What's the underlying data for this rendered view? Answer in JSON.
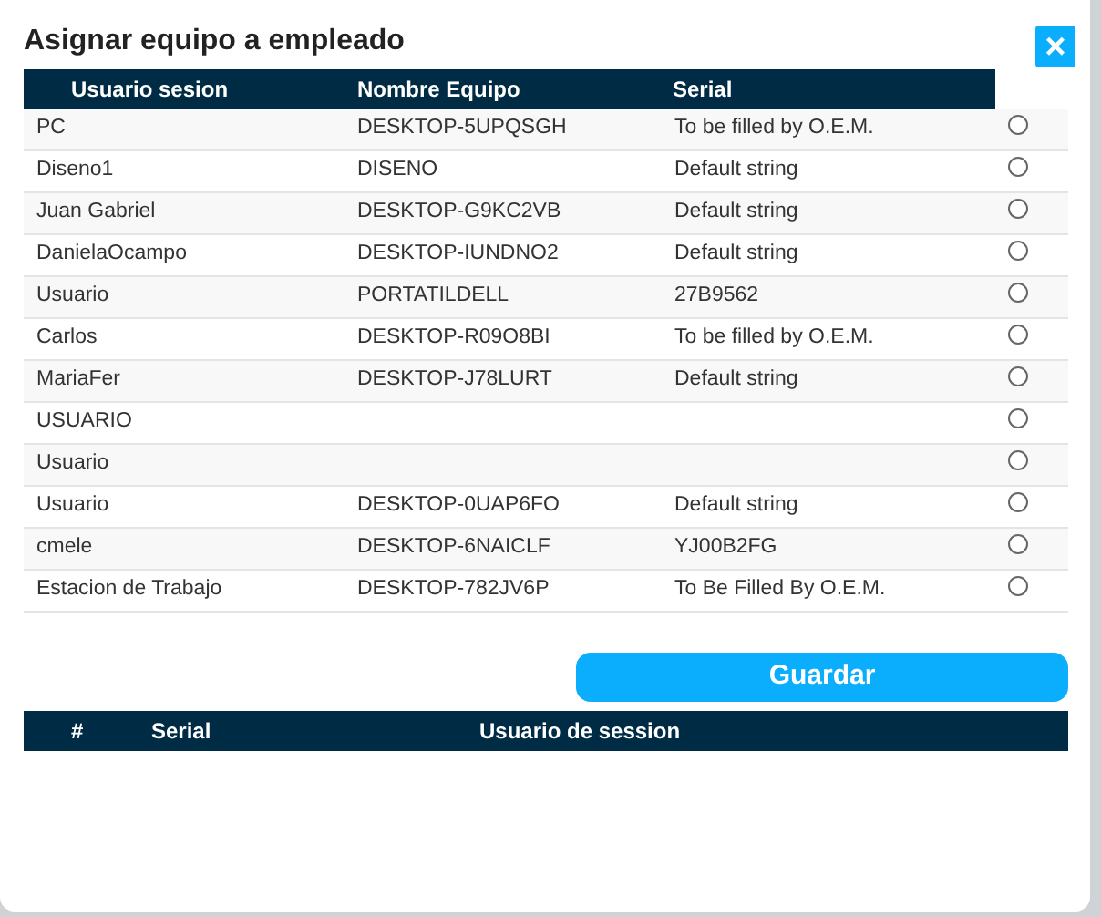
{
  "modal": {
    "title": "Asignar equipo a empleado",
    "close": "×"
  },
  "equipment_table": {
    "columns": [
      "Usuario sesion",
      "Nombre Equipo",
      "Serial"
    ],
    "rows": [
      {
        "user": "PC",
        "computer": "DESKTOP-5UPQSGH",
        "serial": "To be filled by O.E.M.",
        "selected": false
      },
      {
        "user": "Diseno1",
        "computer": "DISENO",
        "serial": "Default string",
        "selected": false
      },
      {
        "user": "Juan Gabriel",
        "computer": "DESKTOP-G9KC2VB",
        "serial": "Default string",
        "selected": false
      },
      {
        "user": "DanielaOcampo",
        "computer": "DESKTOP-IUNDNO2",
        "serial": "Default string",
        "selected": false
      },
      {
        "user": "Usuario",
        "computer": "PORTATILDELL",
        "serial": "27B9562",
        "selected": false
      },
      {
        "user": "Carlos",
        "computer": "DESKTOP-R09O8BI",
        "serial": "To be filled by O.E.M.",
        "selected": false
      },
      {
        "user": "MariaFer",
        "computer": "DESKTOP-J78LURT",
        "serial": "Default string",
        "selected": false
      },
      {
        "user": "USUARIO",
        "selected": false
      },
      {
        "user": "Usuario",
        "selected": false
      },
      {
        "user": "Usuario",
        "computer": "DESKTOP-0UAP6FO",
        "serial": "Default string",
        "selected": false
      },
      {
        "user": "cmele",
        "computer": "DESKTOP-6NAICLF",
        "serial": "YJ00B2FG",
        "selected": false
      },
      {
        "user": "Estacion de Trabajo",
        "computer": "DESKTOP-782JV6P",
        "serial": "To Be Filled By O.E.M.",
        "selected": false
      }
    ]
  },
  "save_button": "Guardar",
  "assigned_table": {
    "columns": [
      "#",
      "Serial",
      "Usuario de session"
    ]
  }
}
